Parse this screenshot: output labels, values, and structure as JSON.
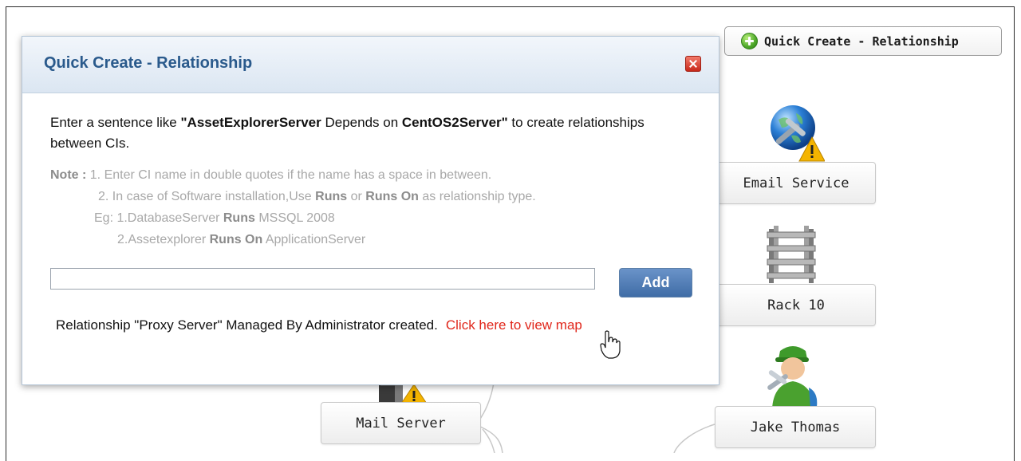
{
  "top_button": {
    "label": "Quick Create - Relationship",
    "icon": "plus-circle-icon"
  },
  "nodes": {
    "email_service": {
      "label": "Email Service",
      "icon": "globe-wrench-warning-icon"
    },
    "rack": {
      "label": "Rack 10",
      "icon": "rack-shelf-icon"
    },
    "person": {
      "label": "Jake Thomas",
      "icon": "technician-icon"
    },
    "mail_server": {
      "label": "Mail Server",
      "icon": "server-warning-icon"
    }
  },
  "dialog": {
    "title": "Quick Create - Relationship",
    "close_icon": "close-icon",
    "intro": {
      "prefix": "Enter a sentence like ",
      "example_server": "\"AssetExplorerServer",
      "depends": " Depends on ",
      "example_target": "CentOS2Server\"",
      "suffix": " to create relationships between CIs."
    },
    "notes": {
      "label": "Note :",
      "line1": " 1. Enter CI name in double quotes if the name has a space in between.",
      "line2_prefix": "2. In case of Software installation,Use ",
      "runs": "Runs",
      "or": " or ",
      "runs_on": "Runs On",
      "line2_suffix": " as relationship type.",
      "eg_prefix": "Eg: 1.DatabaseServer ",
      "eg_runs": "Runs",
      "eg_mssql": " MSSQL 2008",
      "eg2_prefix": "2.Assetexplorer ",
      "eg2_runs_on": "Runs On",
      "eg2_suffix": " ApplicationServer"
    },
    "input": {
      "value": "",
      "placeholder": ""
    },
    "add_label": "Add",
    "status": {
      "message": "Relationship \"Proxy Server\" Managed By Administrator created.",
      "link": "Click here to view map"
    }
  },
  "colors": {
    "title": "#2a5a8c",
    "link": "#e0261a",
    "add_button": "#4a78b3",
    "note_text": "#a8a8a8"
  }
}
